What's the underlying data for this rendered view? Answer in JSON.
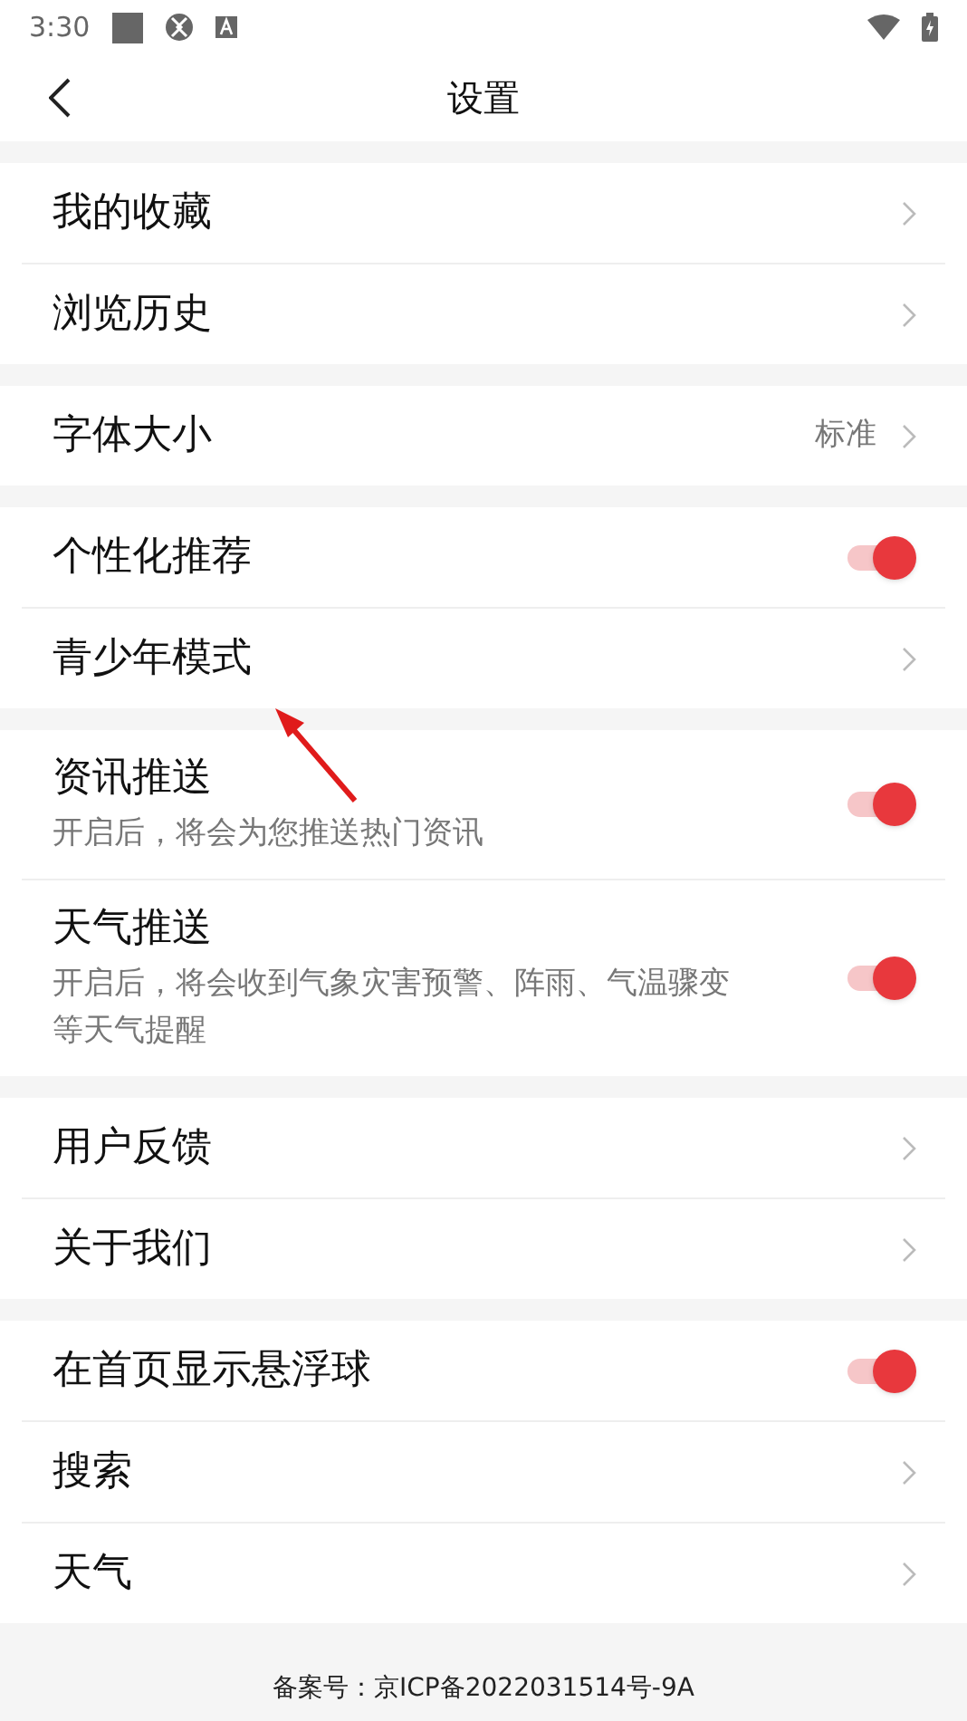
{
  "status_bar": {
    "time": "3:30"
  },
  "header": {
    "title": "设置"
  },
  "sections": [
    {
      "items": [
        {
          "kind": "link",
          "label": "我的收藏"
        },
        {
          "kind": "link",
          "label": "浏览历史"
        }
      ]
    },
    {
      "items": [
        {
          "kind": "link",
          "label": "字体大小",
          "value": "标准"
        }
      ]
    },
    {
      "items": [
        {
          "kind": "toggle",
          "label": "个性化推荐",
          "on": true
        },
        {
          "kind": "link",
          "label": "青少年模式"
        }
      ]
    },
    {
      "items": [
        {
          "kind": "toggle",
          "label": "资讯推送",
          "description": "开启后，将会为您推送热门资讯",
          "on": true
        },
        {
          "kind": "toggle",
          "label": "天气推送",
          "description": "开启后，将会收到气象灾害预警、阵雨、气温骤变等天气提醒",
          "on": true
        }
      ]
    },
    {
      "items": [
        {
          "kind": "link",
          "label": "用户反馈"
        },
        {
          "kind": "link",
          "label": "关于我们"
        }
      ]
    },
    {
      "items": [
        {
          "kind": "toggle",
          "label": "在首页显示悬浮球",
          "on": true
        },
        {
          "kind": "link",
          "label": "搜索"
        },
        {
          "kind": "link",
          "label": "天气"
        }
      ]
    }
  ],
  "footer": {
    "text": "备案号：京ICP备2022031514号-9A"
  }
}
